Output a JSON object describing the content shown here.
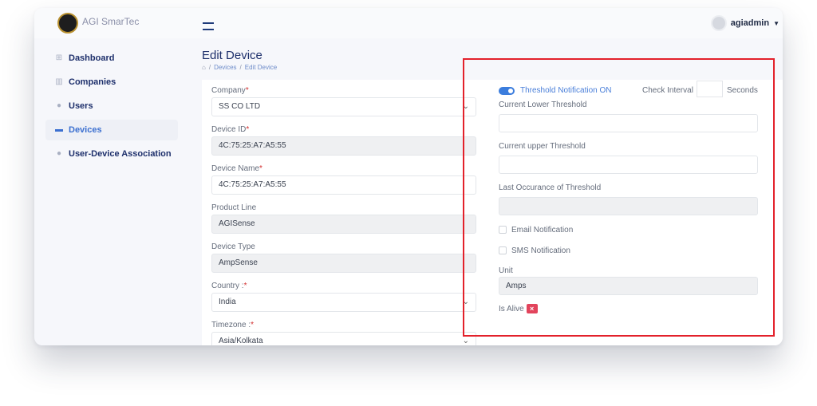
{
  "app": {
    "brand_name": "AGI SmarTec",
    "user_name": "agiadmin"
  },
  "sidebar": {
    "items": [
      {
        "label": "Dashboard",
        "icon": "grid-icon",
        "active": false
      },
      {
        "label": "Companies",
        "icon": "bar-chart-icon",
        "active": false
      },
      {
        "label": "Users",
        "icon": "users-icon",
        "active": false
      },
      {
        "label": "Devices",
        "icon": "device-icon",
        "active": true
      },
      {
        "label": "User-Device Association",
        "icon": "user-device-icon",
        "active": false
      }
    ]
  },
  "page": {
    "title": "Edit Device",
    "breadcrumb": {
      "home_icon": "home-icon",
      "sep": "/",
      "devices": "Devices",
      "current": "Edit Device"
    }
  },
  "form_left": {
    "company_label": "Company",
    "company_value": "SS CO LTD",
    "device_id_label": "Device ID",
    "device_id_value": "4C:75:25:A7:A5:55",
    "device_name_label": "Device Name",
    "device_name_value": "4C:75:25:A7:A5:55",
    "product_line_label": "Product Line",
    "product_line_value": "AGISense",
    "device_type_label": "Device Type",
    "device_type_value": "AmpSense",
    "country_label": "Country :",
    "country_value": "India",
    "timezone_label": "Timezone :",
    "timezone_value": "Asia/Kolkata",
    "required_mark": "*"
  },
  "form_right": {
    "threshold_label": "Threshold Notification ON",
    "threshold_on": true,
    "check_interval_label": "Check Interval",
    "check_interval_value": "",
    "seconds_label": "Seconds",
    "lower_threshold_label": "Current Lower Threshold",
    "lower_threshold_value": "",
    "upper_threshold_label": "Current upper Threshold",
    "upper_threshold_value": "",
    "last_occurance_label": "Last Occurance of Threshold",
    "last_occurance_value": "",
    "email_notification_label": "Email Notification",
    "email_checked": false,
    "sms_notification_label": "SMS Notification",
    "sms_checked": false,
    "unit_label": "Unit",
    "unit_value": "Amps",
    "is_alive_label": "Is Alive",
    "is_alive_badge": "×"
  },
  "colors": {
    "highlight_box": "#e3212b",
    "accent": "#3b7ddd",
    "nav_text": "#1d2f6b",
    "alive_badge": "#e2445c"
  }
}
